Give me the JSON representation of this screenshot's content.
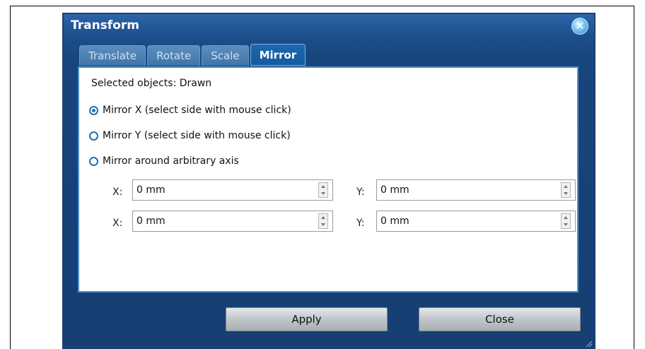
{
  "dialog": {
    "title": "Transform",
    "close_glyph": "✕"
  },
  "tabs": [
    {
      "label": "Translate",
      "active": false
    },
    {
      "label": "Rotate",
      "active": false
    },
    {
      "label": "Scale",
      "active": false
    },
    {
      "label": "Mirror",
      "active": true
    }
  ],
  "panel": {
    "selected_objects": "Selected objects: Drawn",
    "options": [
      {
        "label": "Mirror X (select side with mouse click)",
        "checked": true
      },
      {
        "label": "Mirror Y (select side with mouse click)",
        "checked": false
      },
      {
        "label": "Mirror around arbitrary axis",
        "checked": false
      }
    ],
    "point1": {
      "x_label": "X:",
      "x_value": "0 mm",
      "y_label": "Y:",
      "y_value": "0 mm"
    },
    "point2": {
      "x_label": "X:",
      "x_value": "0 mm",
      "y_label": "Y:",
      "y_value": "0 mm"
    }
  },
  "buttons": {
    "apply": "Apply",
    "close": "Close"
  },
  "icons": {
    "close": "close-icon",
    "radio": "radio-button",
    "spinner": "spinner-arrows-icon",
    "resize": "resize-grip-icon"
  },
  "colors": {
    "title_bar": "#1e4f8d",
    "active_tab": "#145a9e",
    "panel_border": "#4d8fcc",
    "radio_accent": "#1f6fb9"
  }
}
